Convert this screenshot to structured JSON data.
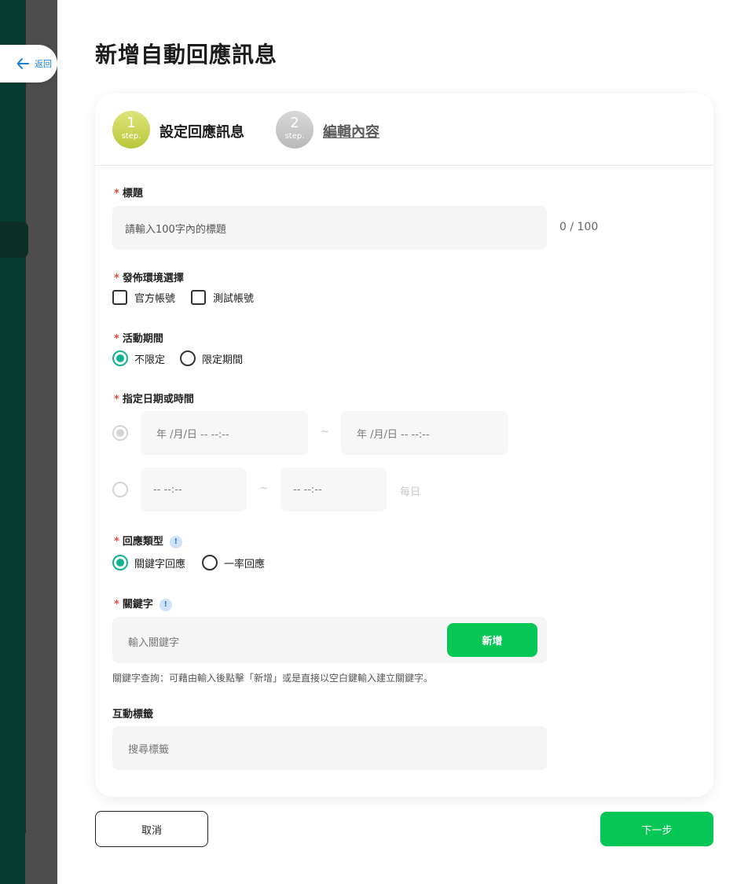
{
  "nav": {
    "back_label": "返回"
  },
  "page": {
    "title": "新增自動回應訊息"
  },
  "steps": [
    {
      "number": "1",
      "sub": "step.",
      "label": "設定回應訊息"
    },
    {
      "number": "2",
      "sub": "step.",
      "label": "編輯內容"
    }
  ],
  "title_field": {
    "required_mark": "*",
    "label": "標題",
    "placeholder": "請輸入100字內的標題",
    "counter": "0 / 100"
  },
  "env_field": {
    "required_mark": "*",
    "label": "發佈環境選擇",
    "options": [
      "官方帳號",
      "測試帳號"
    ]
  },
  "period_field": {
    "required_mark": "*",
    "label": "活動期間",
    "options": [
      "不限定",
      "限定期間"
    ],
    "selected": "不限定"
  },
  "datetime_field": {
    "required_mark": "*",
    "label": "指定日期或時間",
    "date_start": "年 /月/日 -- --:--",
    "date_end": "年 /月/日 -- --:--",
    "time_start": "-- --:--",
    "time_end": "-- --:--",
    "tilde": "~",
    "daily": "每日"
  },
  "reply_type_field": {
    "required_mark": "*",
    "label": "回應類型",
    "info": "!",
    "options": [
      "關鍵字回應",
      "一率回應"
    ],
    "selected": "關鍵字回應"
  },
  "keyword_field": {
    "required_mark": "*",
    "label": "關鍵字",
    "info": "!",
    "placeholder": "輸入關鍵字",
    "add_label": "新增",
    "hint": "關鍵字查詢：可藉由輸入後點擊「新增」或是直接以空白鍵輸入建立關鍵字。"
  },
  "tag_field": {
    "label": "互動標籤",
    "placeholder": "搜尋標籤"
  },
  "footer": {
    "cancel_label": "取消",
    "next_label": "下一步"
  },
  "colors": {
    "brand_green": "#06c755",
    "radio_teal": "#0fb48f",
    "required_red": "#e2493a"
  }
}
